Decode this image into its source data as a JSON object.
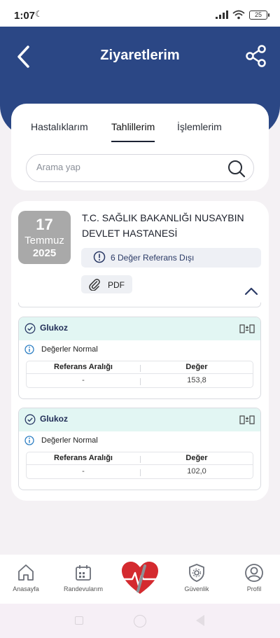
{
  "status_bar": {
    "time": "1:07",
    "battery": "25"
  },
  "header": {
    "title": "Ziyaretlerim"
  },
  "tabs": [
    {
      "label": "Hastalıklarım",
      "active": false
    },
    {
      "label": "Tahlillerim",
      "active": true
    },
    {
      "label": "İşlemlerim",
      "active": false
    }
  ],
  "search": {
    "placeholder": "Arama yap"
  },
  "visit": {
    "day": "17",
    "month": "Temmuz",
    "year": "2025",
    "hospital": "T.C. SAĞLIK BAKANLIĞI NUSAYBIN DEVLET HASTANESİ",
    "reference_alert": "6 Değer Referans Dışı",
    "pdf_label": "PDF"
  },
  "results": [
    {
      "name": "Glukoz",
      "status": "Değerler Normal",
      "col_ref": "Referans Aralığı",
      "col_value": "Değer",
      "ref_range": "-",
      "value": "153,8"
    },
    {
      "name": "Glukoz",
      "status": "Değerler Normal",
      "col_ref": "Referans Aralığı",
      "col_value": "Değer",
      "ref_range": "-",
      "value": "102,0"
    }
  ],
  "bottom_nav": {
    "home": "Anasayfa",
    "appointments": "Randevularım",
    "security": "Güvenlik",
    "profile": "Profil"
  },
  "colors": {
    "header_blue": "#2b4785",
    "result_header": "#e2f6f3",
    "date_box": "#a9a9a9",
    "check_green": "#1f7a5a"
  }
}
